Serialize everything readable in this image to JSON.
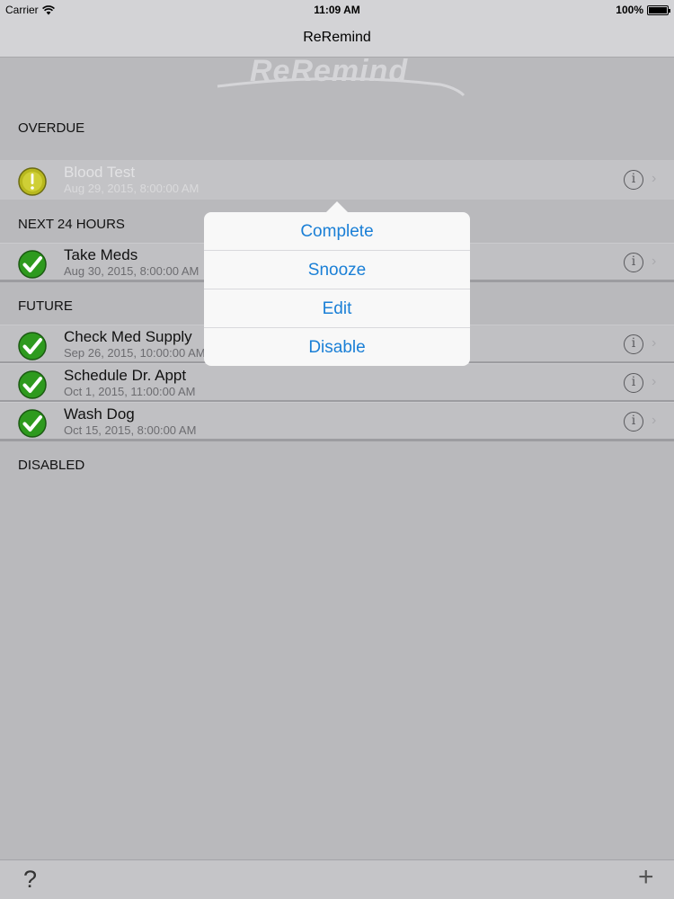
{
  "status_bar": {
    "carrier": "Carrier",
    "time": "11:09 AM",
    "battery": "100%"
  },
  "nav": {
    "title": "ReRemind"
  },
  "logo": {
    "text": "ReRemind"
  },
  "sections": {
    "overdue": "OVERDUE",
    "next24": "NEXT 24 HOURS",
    "future": "FUTURE",
    "disabled": "DISABLED"
  },
  "reminders": [
    {
      "title": "Blood Test",
      "date": "Aug 29, 2015, 8:00:00 AM",
      "status": "overdue"
    },
    {
      "title": "Take Meds",
      "date": "Aug 30, 2015, 8:00:00 AM",
      "status": "ok"
    },
    {
      "title": "Check Med Supply",
      "date": "Sep 26, 2015, 10:00:00 AM",
      "status": "ok"
    },
    {
      "title": "Schedule Dr. Appt",
      "date": "Oct 1, 2015, 11:00:00 AM",
      "status": "ok"
    },
    {
      "title": "Wash Dog",
      "date": "Oct 15, 2015, 8:00:00 AM",
      "status": "ok"
    }
  ],
  "popover_menu": [
    "Complete",
    "Snooze",
    "Edit",
    "Disable"
  ],
  "toolbar": {
    "help_label": "?",
    "add_label": "+"
  },
  "icons": {
    "overdue": "exclamation-circle-icon",
    "ok": "checkmark-circle-icon",
    "info": "info-icon",
    "chevron": "chevron-right-icon",
    "wifi": "wifi-icon",
    "battery": "battery-icon"
  },
  "colors": {
    "accent": "#1a7fd6",
    "check_green": "#2e9a1e",
    "overdue_yellow": "#b8b81e"
  }
}
